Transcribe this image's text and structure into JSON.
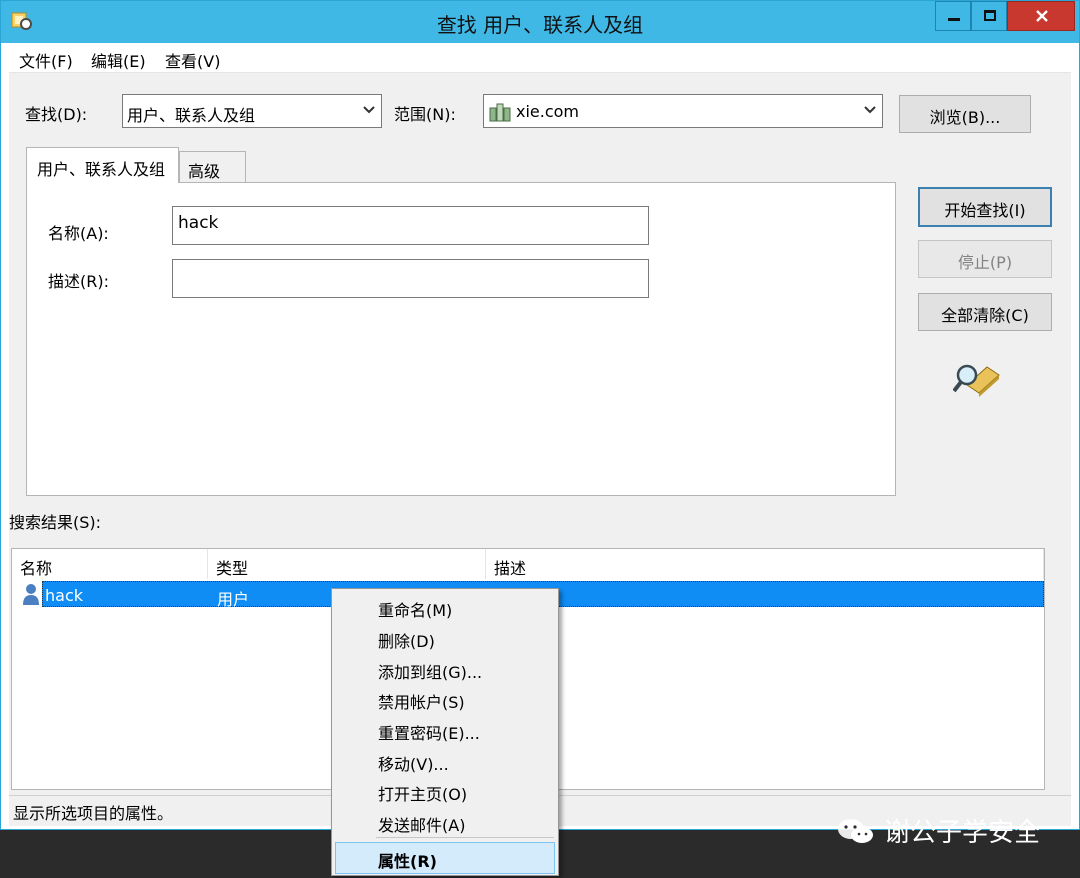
{
  "window": {
    "title": "查找 用户、联系人及组"
  },
  "menubar": {
    "items": [
      "文件(F)",
      "编辑(E)",
      "查看(V)"
    ]
  },
  "find": {
    "label": "查找(D):",
    "value": "用户、联系人及组"
  },
  "scope": {
    "label": "范围(N):",
    "value": "xie.com"
  },
  "browse_button": "浏览(B)...",
  "tabs": [
    "用户、联系人及组",
    "高级"
  ],
  "form": {
    "name_label": "名称(A):",
    "name_value": "hack",
    "desc_label": "描述(R):",
    "desc_value": ""
  },
  "actions": {
    "start": "开始查找(I)",
    "stop": "停止(P)",
    "clear": "全部清除(C)"
  },
  "results": {
    "label": "搜索结果(S):",
    "columns": [
      "名称",
      "类型",
      "描述"
    ],
    "rows": [
      {
        "name": "hack",
        "type": "用户",
        "desc": ""
      }
    ]
  },
  "statusbar": "显示所选项目的属性。",
  "context_menu": {
    "items": [
      "重命名(M)",
      "删除(D)",
      "添加到组(G)...",
      "禁用帐户(S)",
      "重置密码(E)...",
      "移动(V)...",
      "打开主页(O)",
      "发送邮件(A)"
    ],
    "default_item": "属性(R)"
  },
  "watermark": "谢公子学安全",
  "colors": {
    "titlebar": "#3fb8e6",
    "selection": "#0f8df5",
    "close": "#c9382e"
  }
}
